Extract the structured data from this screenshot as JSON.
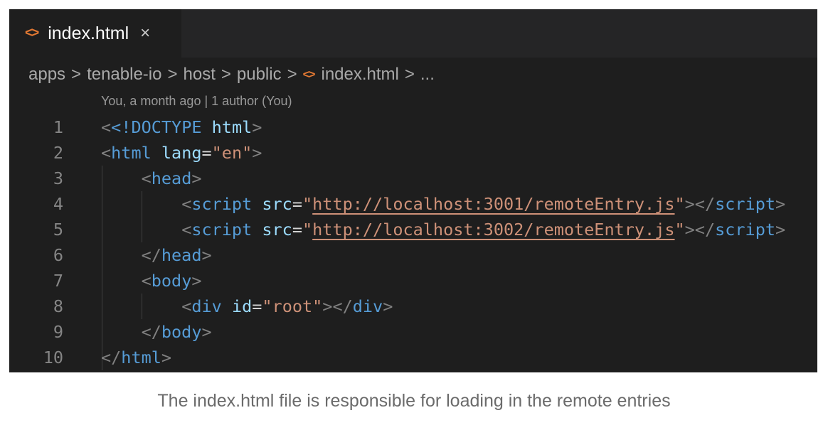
{
  "tab": {
    "icon": "html-code-icon",
    "label": "index.html",
    "close": "×"
  },
  "breadcrumb": [
    "apps",
    "tenable-io",
    "host",
    "public",
    "index.html",
    "..."
  ],
  "codelens": "You, a month ago | 1 author (You)",
  "code": {
    "line_numbers": [
      "1",
      "2",
      "3",
      "4",
      "5",
      "6",
      "7",
      "8",
      "9",
      "10"
    ],
    "doctype_open": "<!DOCTYPE",
    "doctype_name": "html",
    "html_tag": "html",
    "lang_attr": "lang",
    "lang_value": "\"en\"",
    "head_tag": "head",
    "script_tag": "script",
    "src_attr": "src",
    "url1": "http://localhost:3001/remoteEntry.js",
    "url2": "http://localhost:3002/remoteEntry.js",
    "body_tag": "body",
    "div_tag": "div",
    "id_attr": "id",
    "id_value": "\"root\""
  },
  "caption": "The index.html file is responsible for loading in the remote entries"
}
